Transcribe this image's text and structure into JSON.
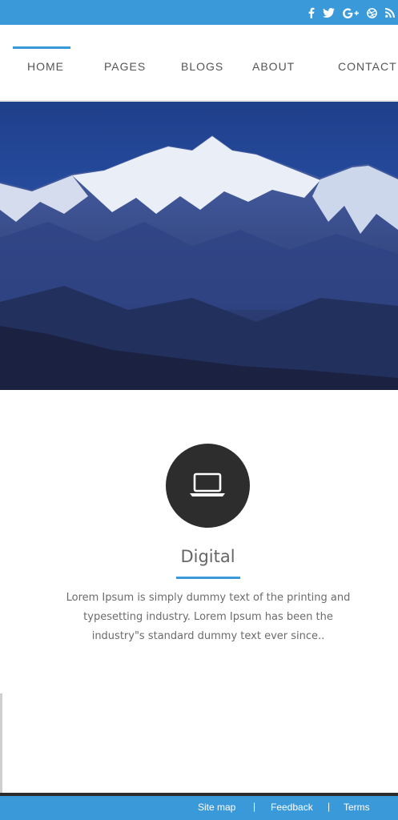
{
  "topbar": {
    "social_icons": [
      "facebook-icon",
      "twitter-icon",
      "google-plus-icon",
      "dribbble-icon",
      "rss-icon"
    ],
    "color": "#3a9ad9"
  },
  "nav": {
    "items": [
      {
        "label": "HOME",
        "active": true
      },
      {
        "label": "PAGES"
      },
      {
        "label": "BLOGS"
      },
      {
        "label": "ABOUT"
      },
      {
        "label": "CONTACT"
      }
    ]
  },
  "hero": {
    "image": "snow-capped mountain range under blue sky"
  },
  "feature": {
    "icon": "laptop-icon",
    "title": "Digital",
    "text_lines": [
      "Lorem Ipsum is simply dummy text of the printing and",
      "typesetting industry. Lorem Ipsum has been the",
      "industry\"s standard dummy text ever since.."
    ]
  },
  "footer": {
    "links": [
      "Site map",
      "Feedback",
      "Terms"
    ],
    "separator": "|"
  },
  "colors": {
    "accent": "#3a9ad9",
    "dark": "#2d2d2d",
    "text": "#6b6b6b"
  }
}
